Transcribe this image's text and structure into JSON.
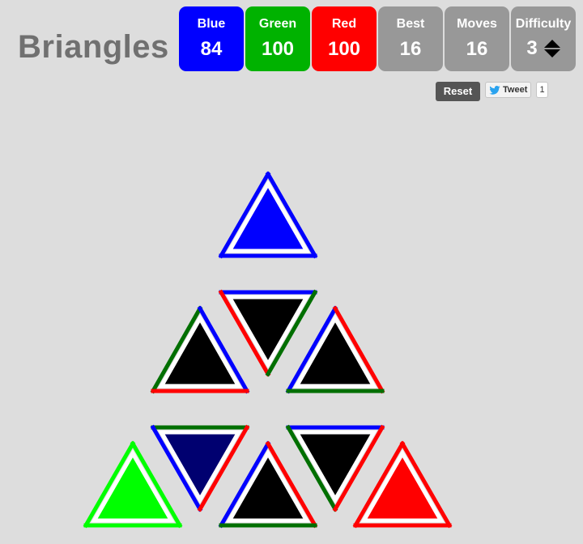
{
  "app": {
    "title": "Briangles"
  },
  "scores": [
    {
      "label": "Blue",
      "value": "84",
      "color": "#0000ff"
    },
    {
      "label": "Green",
      "value": "100",
      "color": "#00b200"
    },
    {
      "label": "Red",
      "value": "100",
      "color": "#ff0000"
    },
    {
      "label": "Best",
      "value": "16",
      "color": "#989898"
    },
    {
      "label": "Moves",
      "value": "16",
      "color": "#989898"
    }
  ],
  "difficulty": {
    "label": "Difficulty",
    "value": "3",
    "color": "#989898"
  },
  "controls": {
    "reset_label": "Reset",
    "tweet_label": "Tweet",
    "tweet_count": "1"
  },
  "colors": {
    "blue": "#0000ff",
    "green": "#006f00",
    "red": "#ff0000",
    "black": "#000000",
    "navy": "#000070",
    "lime": "#00ff00",
    "white": "#ffffff"
  },
  "board": {
    "triangles": [
      {
        "id": "t-top",
        "orientation": "up",
        "fill": "#0000ff",
        "edges": {
          "left": "#0000ff",
          "right": "#0000ff",
          "bottom": "#0000ff"
        }
      },
      {
        "id": "t-mid-left",
        "orientation": "up",
        "fill": "#000000",
        "edges": {
          "left": "#006f00",
          "right": "#0000ff",
          "bottom": "#ff0000"
        }
      },
      {
        "id": "t-mid-center",
        "orientation": "down",
        "fill": "#000000",
        "edges": {
          "left": "#ff0000",
          "right": "#006f00",
          "top": "#0000ff"
        }
      },
      {
        "id": "t-mid-right",
        "orientation": "up",
        "fill": "#000000",
        "edges": {
          "left": "#0000ff",
          "right": "#ff0000",
          "bottom": "#006f00"
        }
      },
      {
        "id": "t-bot-1",
        "orientation": "up",
        "fill": "#00ff00",
        "edges": {
          "left": "#00ff00",
          "right": "#00ff00",
          "bottom": "#00ff00"
        }
      },
      {
        "id": "t-bot-2",
        "orientation": "down",
        "fill": "#000070",
        "edges": {
          "left": "#0000ff",
          "right": "#ff0000",
          "top": "#006f00"
        }
      },
      {
        "id": "t-bot-3",
        "orientation": "up",
        "fill": "#000000",
        "edges": {
          "left": "#0000ff",
          "right": "#ff0000",
          "bottom": "#006f00"
        }
      },
      {
        "id": "t-bot-4",
        "orientation": "down",
        "fill": "#000000",
        "edges": {
          "left": "#006f00",
          "right": "#ff0000",
          "top": "#0000ff"
        }
      },
      {
        "id": "t-bot-5",
        "orientation": "up",
        "fill": "#ff0000",
        "edges": {
          "left": "#ff0000",
          "right": "#ff0000",
          "bottom": "#ff0000"
        }
      }
    ]
  }
}
